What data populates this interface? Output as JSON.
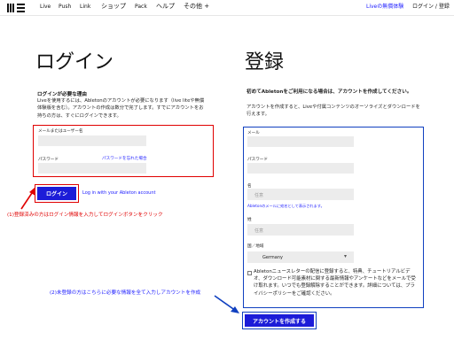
{
  "nav": {
    "items": [
      "Live",
      "Push",
      "Link",
      "ショップ",
      "Pack",
      "ヘルプ",
      "その他 +"
    ],
    "promo": "Liveの無償体験",
    "login_link": "ログイン / 登録"
  },
  "login": {
    "title": "ログイン",
    "subtitle": "ログインが必要な理由",
    "description": "Liveを使用するには、Abletonのアカウントが必要になります（live liteや無償体験版を含む）。アカウントの作成は数分で完了します。すでにアカウントをお持ちの方は、すぐにログインできます。",
    "username_label": "メールまたはユーザー名",
    "password_label": "パスワード",
    "forgot_link": "パスワードを忘れた場合",
    "login_button": "ログイン",
    "ableton_link": "Log in with your Ableton account"
  },
  "register": {
    "title": "登録",
    "subtitle": "初めてAbletonをご利用になる場合は、アカウントを作成してください。",
    "description": "アカウントを作成すると、Liveや付属コンテンツのオーソライズとダウンロードを行えます。",
    "email_label": "メール",
    "password_label": "パスワード",
    "name_label": "名",
    "first_name_placeholder": "任意",
    "name_hint": "Abletonのメールに宛名として表示されます。",
    "last_name_label": "姓",
    "last_name_placeholder": "任意",
    "country_label": "国／地域",
    "country_value": "Germany",
    "newsletter_text": "Abletonニュースレターの配信に登録すると、特典、チュートリアルビデオ、ダウンロード可能素材に関する最新情報やアンケートなどをメールで受け取れます。いつでも登録解除することができます。詳細については、プライバシーポリシーをご確認ください。",
    "create_button": "アカウントを作成する"
  },
  "annotations": {
    "login_note": "(1)登録済みの方はログイン情報を入力してログインボタンをクリック",
    "register_note": "(2)未登録の方はこちらに必要な情報を全て入力しアカウントを作成"
  },
  "colors": {
    "accent": "#1c1cd8",
    "annotation_red": "#e00000",
    "annotation_blue": "#1040c0"
  }
}
